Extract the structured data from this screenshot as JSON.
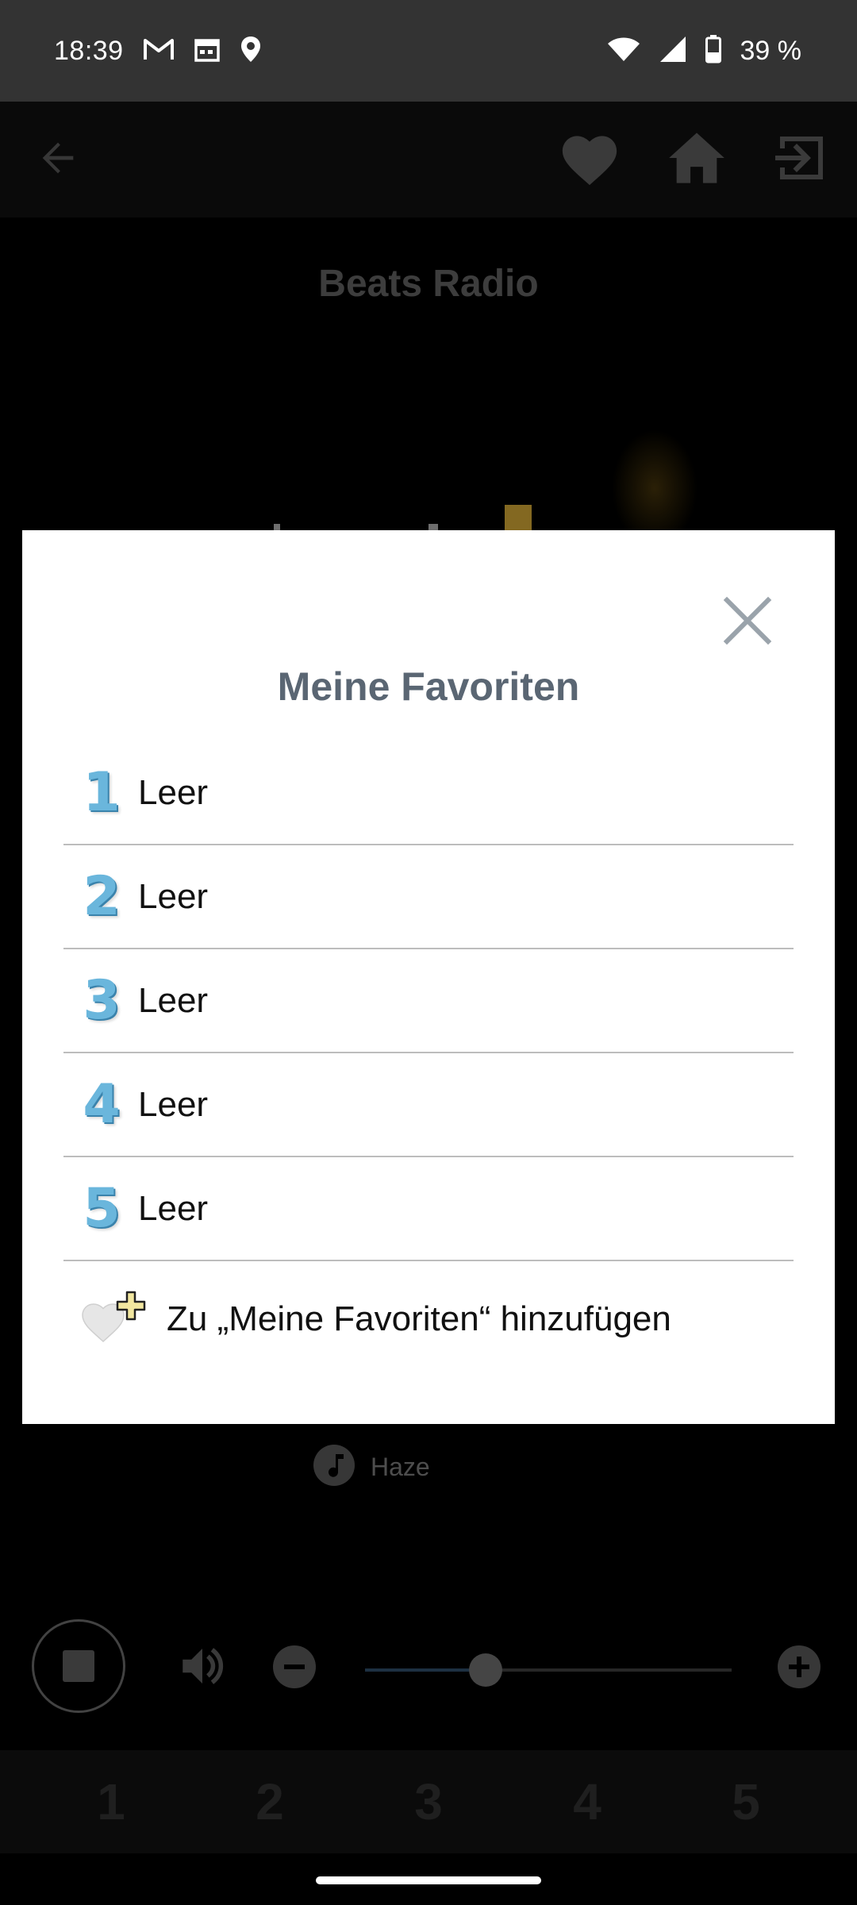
{
  "status_bar": {
    "time": "18:39",
    "icons": [
      "gmail-icon",
      "calendar-icon",
      "location-icon"
    ],
    "right_icons": [
      "wifi-icon",
      "signal-icon",
      "battery-icon"
    ],
    "battery_text": "39 %"
  },
  "toolbar": {
    "back_icon": "back-arrow-icon",
    "actions": [
      "heart-icon",
      "home-icon",
      "exit-icon"
    ]
  },
  "station": {
    "title": "Beats Radio"
  },
  "now_playing": {
    "track": "Haze",
    "icon": "music-note-icon"
  },
  "player": {
    "volume_level": 0.33,
    "stop_icon": "stop-icon",
    "volume_icon": "volume-icon",
    "minus_icon": "minus-icon",
    "plus_icon": "plus-icon"
  },
  "presets": [
    "1",
    "2",
    "3",
    "4",
    "5"
  ],
  "dialog": {
    "title": "Meine Favoriten",
    "close_icon": "close-icon",
    "items": [
      {
        "number": "1",
        "label": "Leer"
      },
      {
        "number": "2",
        "label": "Leer"
      },
      {
        "number": "3",
        "label": "Leer"
      },
      {
        "number": "4",
        "label": "Leer"
      },
      {
        "number": "5",
        "label": "Leer"
      }
    ],
    "add_label": "Zu „Meine Favoriten“ hinzufügen",
    "add_icon": "heart-plus-icon"
  },
  "colors": {
    "accent_blue": "#6ab6dc",
    "title_gray": "#5a6673",
    "equalizer_gold": "#c9a033"
  }
}
